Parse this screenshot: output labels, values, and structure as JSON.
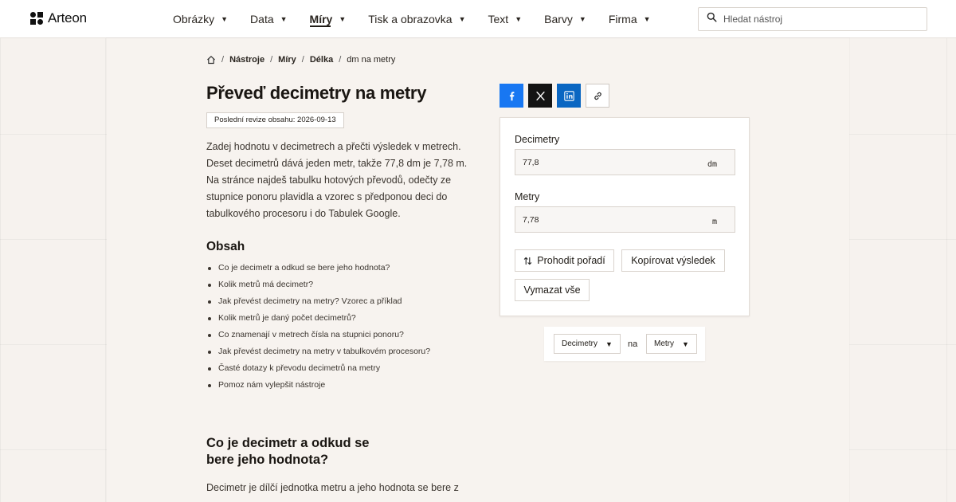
{
  "brand": {
    "name": "Arteon"
  },
  "nav": {
    "items": [
      {
        "label": "Obrázky"
      },
      {
        "label": "Data"
      },
      {
        "label": "Míry"
      },
      {
        "label": "Tisk a obrazovka"
      },
      {
        "label": "Text"
      },
      {
        "label": "Barvy"
      },
      {
        "label": "Firma"
      }
    ],
    "active": "Míry"
  },
  "search": {
    "placeholder": "Hledat nástroj"
  },
  "breadcrumb": {
    "items": [
      "Nástroje",
      "Míry",
      "Délka"
    ],
    "current": "dm na metry"
  },
  "page": {
    "title": "Převeď decimetry na metry",
    "revision": "Poslední revize obsahu: 2026-09-13",
    "intro": "Zadej hodnotu v decimetrech a přečti výsledek v metrech. Deset decimetrů dává jeden metr, takže 77,8 dm je 7,78 m. Na stránce najdeš tabulku hotových převodů, odečty ze stupnice ponoru plavidla a vzorec s předponou deci do tabulkového procesoru i do Tabulek Google."
  },
  "toc": {
    "title": "Obsah",
    "items": [
      "Co je decimetr a odkud se bere jeho hodnota?",
      "Kolik metrů má decimetr?",
      "Jak převést decimetry na metry? Vzorec a příklad",
      "Kolik metrů je daný počet decimetrů?",
      "Co znamenají v metrech čísla na stupnici ponoru?",
      "Jak převést decimetry na metry v tabulkovém procesoru?",
      "Časté dotazy k převodu decimetrů na metry",
      "Pomoz nám vylepšit nástroje"
    ]
  },
  "section": {
    "title": "Co je decimetr a odkud se bere jeho hodnota?",
    "text": "Decimetr je dílčí jednotka metru a jeho hodnota se bere z"
  },
  "share": {
    "icons": [
      "facebook-icon",
      "x-icon",
      "linkedin-icon",
      "link-icon"
    ],
    "colors": {
      "facebook": "#1877f2",
      "x": "#141414",
      "linkedin": "#0a66c2"
    }
  },
  "converter": {
    "from": {
      "label": "Decimetry",
      "value": "77,8",
      "unit": "dm"
    },
    "to": {
      "label": "Metry",
      "value": "7,78",
      "unit": "m"
    },
    "buttons": {
      "swap": "Prohodit pořadí",
      "copy": "Kopírovat výsledek",
      "clear": "Vymazat vše"
    }
  },
  "unit_picker": {
    "from": "Decimetry",
    "connector": "na",
    "to": "Metry"
  }
}
